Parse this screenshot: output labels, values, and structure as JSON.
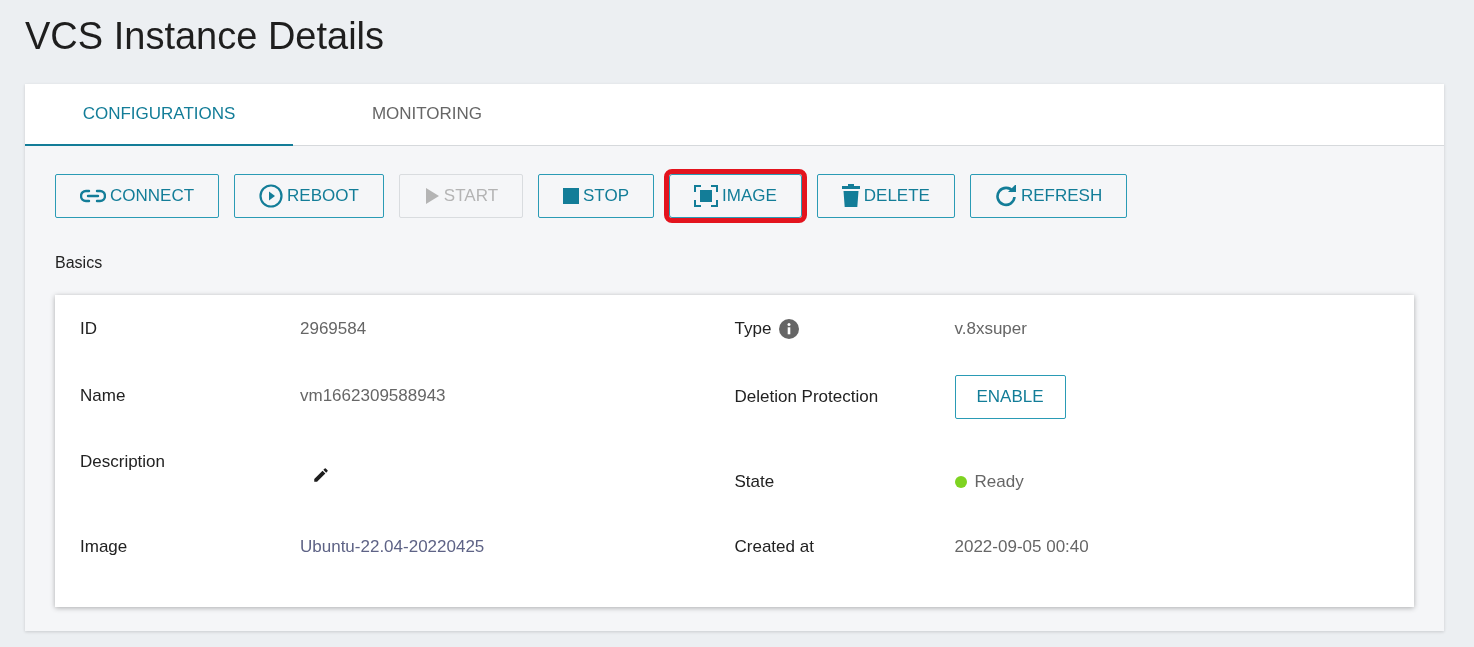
{
  "title": "VCS Instance Details",
  "tabs": [
    {
      "label": "CONFIGURATIONS",
      "selected": true
    },
    {
      "label": "MONITORING",
      "selected": false
    }
  ],
  "actions": [
    {
      "label": "CONNECT",
      "kind": "link",
      "disabled": false,
      "highlighted": false
    },
    {
      "label": "REBOOT",
      "kind": "play-circle",
      "disabled": false,
      "highlighted": false
    },
    {
      "label": "START",
      "kind": "play",
      "disabled": true,
      "highlighted": false
    },
    {
      "label": "STOP",
      "kind": "stop",
      "disabled": false,
      "highlighted": false
    },
    {
      "label": "IMAGE",
      "kind": "image",
      "disabled": false,
      "highlighted": true
    },
    {
      "label": "DELETE",
      "kind": "trash",
      "disabled": false,
      "highlighted": false
    },
    {
      "label": "REFRESH",
      "kind": "refresh",
      "disabled": false,
      "highlighted": false
    }
  ],
  "section_title": "Basics",
  "left_fields": [
    {
      "kind": "text",
      "label": "ID",
      "value": "2969584"
    },
    {
      "kind": "text",
      "label": "Name",
      "value": "vm1662309588943"
    },
    {
      "kind": "edit",
      "label": "Description"
    },
    {
      "kind": "link",
      "label": "Image",
      "value": "Ubuntu-22.04-20220425"
    }
  ],
  "right_fields": [
    {
      "kind": "info",
      "label": "Type",
      "value": "v.8xsuper"
    },
    {
      "kind": "button",
      "label": "Deletion Protection",
      "value": "ENABLE"
    },
    {
      "kind": "status",
      "label": "State",
      "value": "Ready",
      "color": "#7ed321"
    },
    {
      "kind": "text",
      "label": "Created at",
      "value": "2022-09-05 00:40"
    }
  ]
}
